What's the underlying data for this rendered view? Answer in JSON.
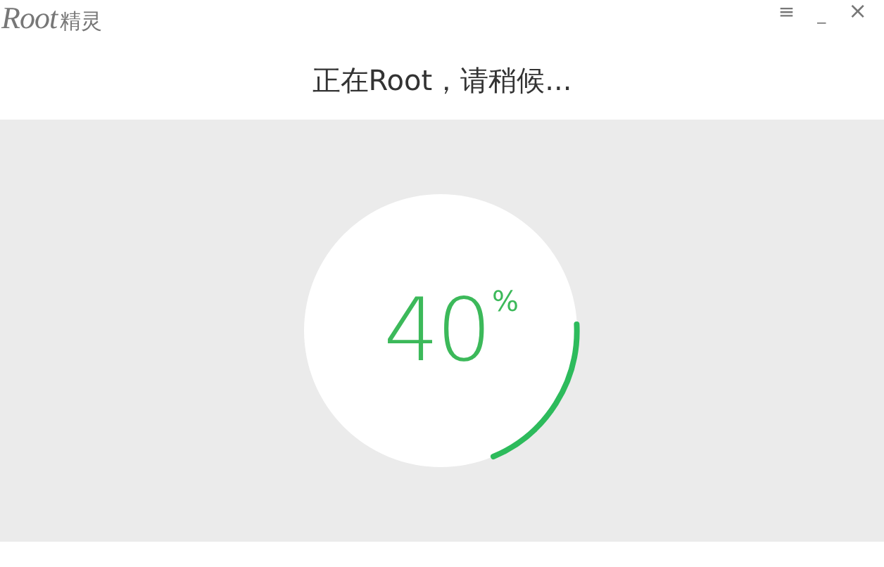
{
  "window": {
    "logo_latin": "Root",
    "logo_cjk": "精灵",
    "controls": [
      {
        "kind": "menu",
        "label": "≡"
      },
      {
        "kind": "minimize",
        "label": "_"
      },
      {
        "kind": "close",
        "label": "×"
      }
    ]
  },
  "heading": "正在Root，请稍候...",
  "progress": {
    "value": "40",
    "unit": "%"
  }
}
